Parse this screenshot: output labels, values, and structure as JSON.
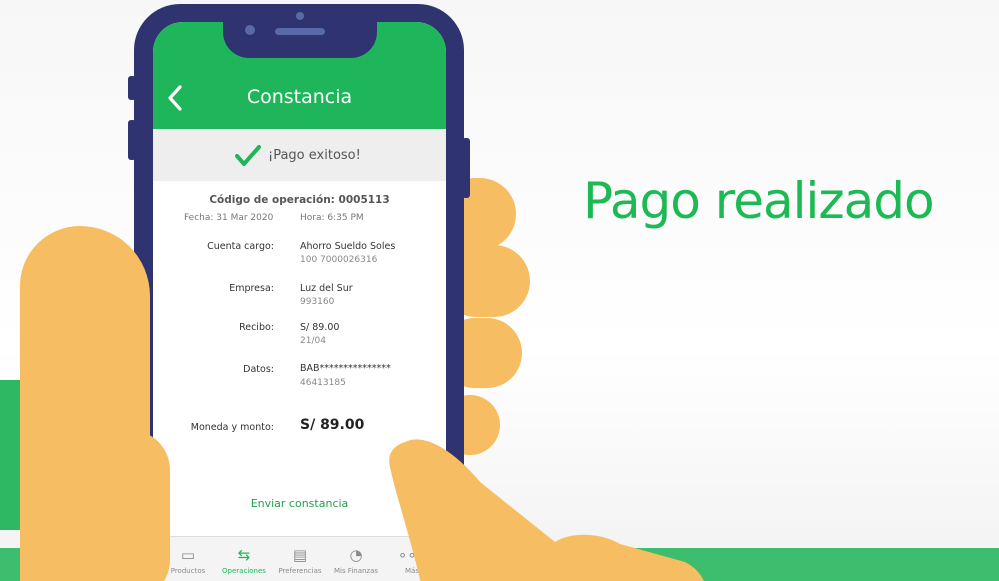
{
  "headline": "Pago realizado",
  "app": {
    "title": "Constancia",
    "success_message": "¡Pago exitoso!",
    "operation_code": "Código de operación: 0005113",
    "date": "Fecha: 31 Mar 2020",
    "time": "Hora: 6:35 PM"
  },
  "details": [
    {
      "label": "Cuenta cargo:",
      "value": "Ahorro Sueldo Soles",
      "sub": "100 7000026316"
    },
    {
      "label": "Empresa:",
      "value": "Luz del Sur",
      "sub": "993160"
    },
    {
      "label": "Recibo:",
      "value": "S/ 89.00",
      "sub": "21/04"
    },
    {
      "label": "Datos:",
      "value": "BAB***************",
      "sub": "46413185"
    }
  ],
  "total": {
    "label": "Moneda y monto:",
    "value": "S/ 89.00"
  },
  "send_link": "Enviar constancia",
  "tabs": [
    {
      "label": "Productos",
      "icon": "wallet-icon"
    },
    {
      "label": "Operaciones",
      "icon": "transfer-arrows-icon"
    },
    {
      "label": "Preferencias",
      "icon": "cards-icon"
    },
    {
      "label": "Mis Finanzas",
      "icon": "pie-chart-icon"
    },
    {
      "label": "Más",
      "icon": "more-dots-icon"
    }
  ],
  "colors": {
    "brand_green": "#1fb55a",
    "phone_frame": "#2f3470",
    "hand": "#f6bd62"
  }
}
